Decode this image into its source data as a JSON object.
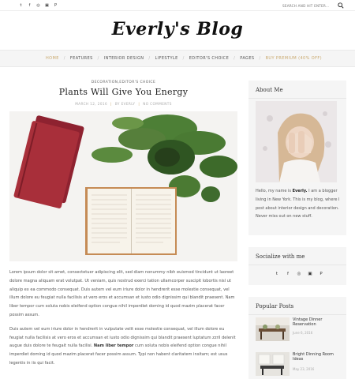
{
  "topbar": {
    "social": [
      {
        "icon": "twitter-icon",
        "glyph": "t"
      },
      {
        "icon": "facebook-icon",
        "glyph": "f"
      },
      {
        "icon": "instagram-icon",
        "glyph": "◎"
      },
      {
        "icon": "youtube-icon",
        "glyph": "▣"
      },
      {
        "icon": "pinterest-icon",
        "glyph": "P"
      }
    ],
    "search_placeholder": "SEARCH AND HIT ENTER..."
  },
  "logo": "Everly's Blog",
  "nav": {
    "items": [
      "HOME",
      "FEATURES",
      "INTERIOR DESIGN",
      "LIFESTYLE",
      "EDITOR'S CHOICE",
      "PAGES",
      "BUY PREMIUM (40% OFF)"
    ]
  },
  "post": {
    "categories": "DECORATION,EDITOR'S CHOICE",
    "title": "Plants Will Give You Energy",
    "date": "MARCH 12, 2016",
    "author": "BY EVERLY",
    "comments": "NO COMMENTS",
    "para1": "Lorem ipsum dolor sit amet, consectetuer adipiscing elit, sed diam nonummy nibh euismod tincidunt ut laoreet dolore magna aliquam erat volutpat. Ut veniam, quis nostrud exerci tation ullamcorper suscipit lobortis nisl ut aliquip ex ea commodo consequat. Duis autem vel eum iriure dolor in hendrerit esse molestie consequat, vel illum dolore eu feugiat nulla facilisis at vero eros et accumsan et iusto odio dignissim qui blandit praesent. Nam liber tempor cum soluta nobis eleifend option congue nihil imperdiet doming id quod mazim placerat facer possim assum.",
    "para2_a": "Duis autem vel eum iriure dolor in hendrerit in vulputate velit esse molestie consequat, vel illum dolore eu feugiat nulla facilisis at vero eros et accumsan et iusto odio dignissim qui blandit praesent luptatum zzril delenit augue duis dolore te feugait nulla facilisi. ",
    "para2_bold": "Nam liber tempor",
    "para2_b": " cum soluta nobis eleifend option congue nihil imperdiet doming id quod mazim placerat facer possim assum. Typi non habent claritatem insitam; est usus legentis in iis qui facit."
  },
  "sidebar": {
    "about_title": "About Me",
    "about_text_a": "Hello, my name is ",
    "about_name": "Everly.",
    "about_text_b": " I am a blogger living in New York. This is my blog, where I post about interior design and decoration. Never miss out on new stuff.",
    "social_title": "Socialize with me",
    "social": [
      {
        "icon": "twitter-icon",
        "glyph": "t"
      },
      {
        "icon": "facebook-icon",
        "glyph": "f"
      },
      {
        "icon": "instagram-icon",
        "glyph": "◎"
      },
      {
        "icon": "youtube-icon",
        "glyph": "▣"
      },
      {
        "icon": "pinterest-icon",
        "glyph": "P"
      }
    ],
    "popular_title": "Popular Posts",
    "popular": [
      {
        "title": "Vintage Dinner Reservation",
        "date": "June 6, 2016"
      },
      {
        "title": "Bright Dinning Room Ideas",
        "date": "May 23, 2016"
      }
    ]
  },
  "colors": {
    "accent": "#c9a96e",
    "sidebar_bg": "#f5f5f5",
    "book_red": "#a82f3a",
    "plant_green": "#3f6b2e"
  }
}
